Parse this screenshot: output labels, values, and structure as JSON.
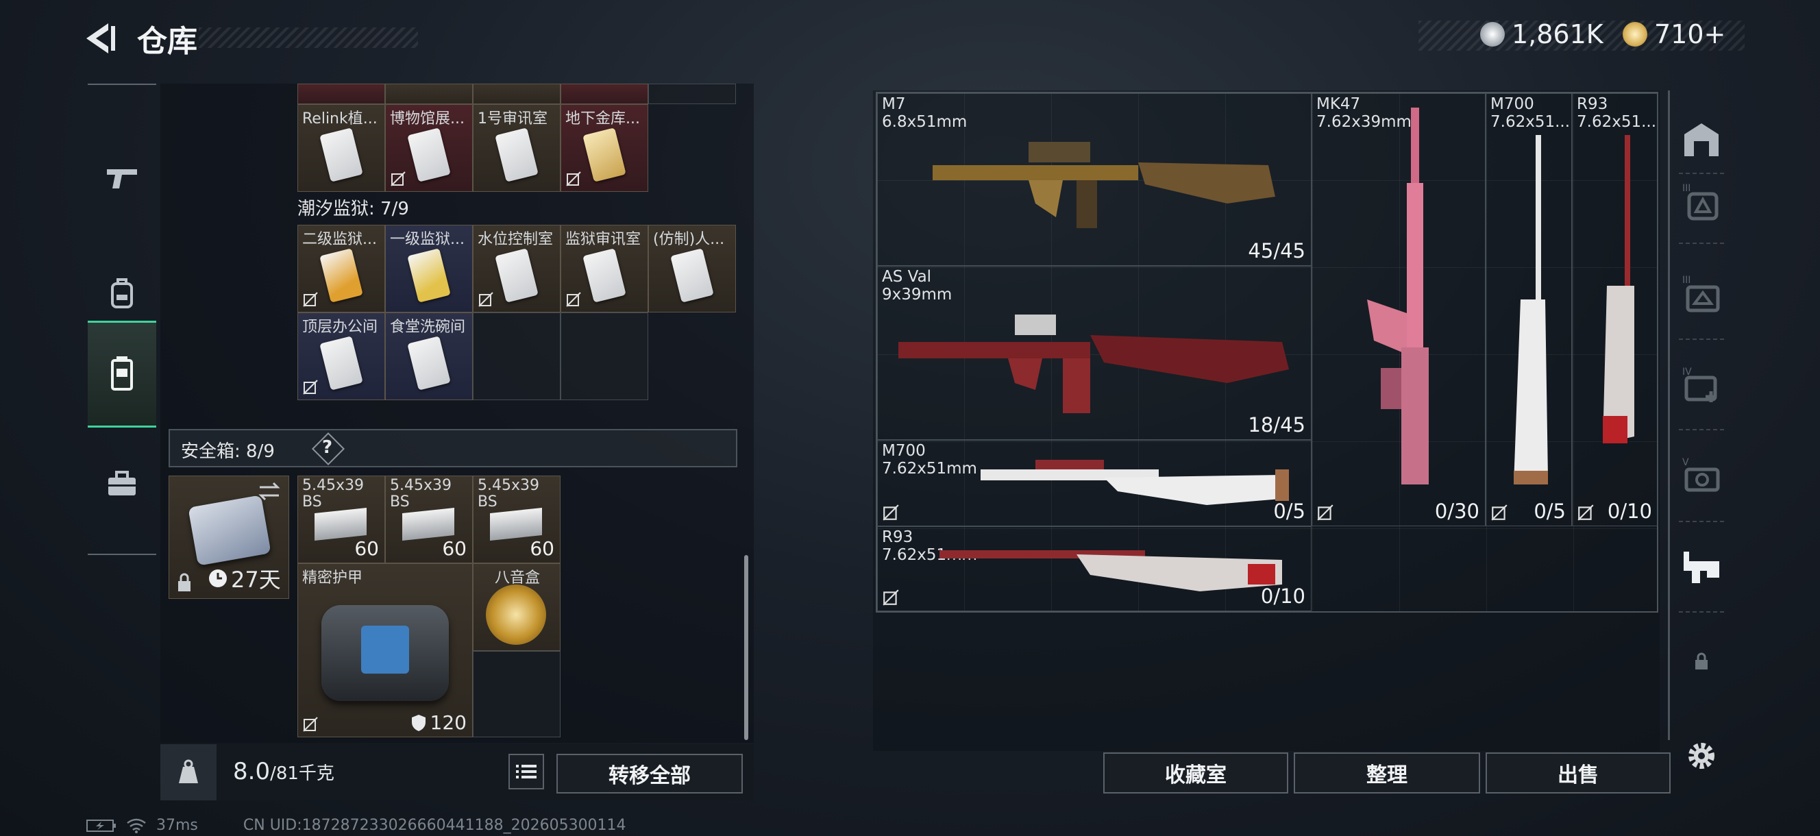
{
  "header": {
    "title": "仓库",
    "currency1": "1,861K",
    "currency2": "710+"
  },
  "left_nav": [
    "gun-icon",
    "backpack-icon",
    "chest-rig-icon",
    "case-icon"
  ],
  "prev_row_items": [
    {
      "label": "Relink植..."
    },
    {
      "label": "博物馆展..."
    },
    {
      "label": "1号审讯室"
    },
    {
      "label": "地下金库..."
    }
  ],
  "prison_section": {
    "label": "潮汐监狱: 7/9"
  },
  "prison_items": [
    {
      "label": "二级监狱..."
    },
    {
      "label": "一级监狱..."
    },
    {
      "label": "水位控制室"
    },
    {
      "label": "监狱审讯室"
    },
    {
      "label": "(仿制)人..."
    },
    {
      "label": "顶层办公间"
    },
    {
      "label": "食堂洗碗间"
    }
  ],
  "safebox": {
    "label": "安全箱: 8/9",
    "help": "?",
    "timer": "27天"
  },
  "safe_items": [
    {
      "label": "5.45x39 BS",
      "count": "60"
    },
    {
      "label": "5.45x39 BS",
      "count": "60"
    },
    {
      "label": "5.45x39 BS",
      "count": "60"
    },
    {
      "label": "精密护甲",
      "durability": "120"
    },
    {
      "label": "八音盒"
    }
  ],
  "weight": {
    "current": "8.0",
    "max": "/81千克"
  },
  "buttons": {
    "transfer_all": "转移全部",
    "collection": "收藏室",
    "organize": "整理",
    "sell": "出售"
  },
  "weapons": [
    {
      "name": "M7",
      "caliber": "6.8x51mm",
      "ammo": "45/45"
    },
    {
      "name": "AS Val",
      "caliber": "9x39mm",
      "ammo": "18/45"
    },
    {
      "name": "M700",
      "caliber": "7.62x51mm",
      "ammo": "0/5"
    },
    {
      "name": "R93",
      "caliber": "7.62x51mm",
      "ammo": "0/10"
    },
    {
      "name": "MK47",
      "caliber": "7.62x39mm",
      "ammo": "0/30"
    },
    {
      "name": "M700",
      "caliber": "7.62x51...",
      "ammo": "0/5"
    },
    {
      "name": "R93",
      "caliber": "7.62x51...",
      "ammo": "0/10"
    }
  ],
  "right_nav": [
    "storage-icon",
    "armor-tier3-icon",
    "helmet-tier3-icon",
    "medkit-tier4-icon",
    "camera-tier5-icon",
    "weapon-bench-icon",
    "lock-icon",
    "settings-icon"
  ],
  "status": {
    "ping": "37ms",
    "uid": "CN UID:187287233026660441188_202605300114"
  }
}
